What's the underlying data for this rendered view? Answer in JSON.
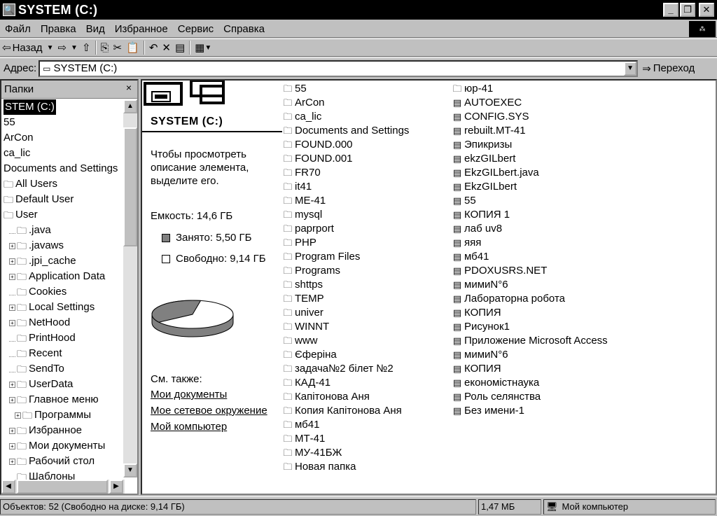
{
  "window": {
    "title": "SYSTEM (C:)"
  },
  "menu": [
    "Файл",
    "Правка",
    "Вид",
    "Избранное",
    "Сервис",
    "Справка"
  ],
  "toolbar": {
    "back_label": "Назад"
  },
  "address": {
    "label": "Адрес:",
    "value": "SYSTEM (C:)",
    "go_label": "Переход"
  },
  "folders": {
    "header": "Папки",
    "close": "×",
    "items": [
      {
        "label": "STEM (C:)",
        "indent": 0,
        "selected": true,
        "plus": false,
        "icon": false
      },
      {
        "label": "55",
        "indent": 0,
        "plus": false,
        "icon": false
      },
      {
        "label": "ArCon",
        "indent": 0,
        "plus": false,
        "icon": false
      },
      {
        "label": "ca_lic",
        "indent": 0,
        "plus": false,
        "icon": false
      },
      {
        "label": "Documents and Settings",
        "indent": 0,
        "plus": false,
        "icon": false
      },
      {
        "label": "All Users",
        "indent": 0,
        "plus": false,
        "icon": true
      },
      {
        "label": "Default User",
        "indent": 0,
        "plus": false,
        "icon": true
      },
      {
        "label": "User",
        "indent": 0,
        "plus": false,
        "icon": true
      },
      {
        "label": ".java",
        "indent": 1,
        "plus": false,
        "icon": true
      },
      {
        "label": ".javaws",
        "indent": 1,
        "plus": true,
        "icon": true
      },
      {
        "label": ".jpi_cache",
        "indent": 1,
        "plus": true,
        "icon": true
      },
      {
        "label": "Application Data",
        "indent": 1,
        "plus": true,
        "icon": true
      },
      {
        "label": "Cookies",
        "indent": 1,
        "plus": false,
        "icon": true
      },
      {
        "label": "Local Settings",
        "indent": 1,
        "plus": true,
        "icon": true
      },
      {
        "label": "NetHood",
        "indent": 1,
        "plus": true,
        "icon": true
      },
      {
        "label": "PrintHood",
        "indent": 1,
        "plus": false,
        "icon": true
      },
      {
        "label": "Recent",
        "indent": 1,
        "plus": false,
        "icon": true
      },
      {
        "label": "SendTo",
        "indent": 1,
        "plus": false,
        "icon": true
      },
      {
        "label": "UserData",
        "indent": 1,
        "plus": true,
        "icon": true
      },
      {
        "label": "Главное меню",
        "indent": 1,
        "plus": true,
        "icon": true
      },
      {
        "label": "Программы",
        "indent": 2,
        "plus": true,
        "icon": true
      },
      {
        "label": "Избранное",
        "indent": 1,
        "plus": true,
        "icon": true
      },
      {
        "label": "Мои документы",
        "indent": 1,
        "plus": true,
        "icon": true
      },
      {
        "label": "Рабочий стол",
        "indent": 1,
        "plus": true,
        "icon": true
      },
      {
        "label": "Шаблоны",
        "indent": 1,
        "plus": false,
        "icon": true
      }
    ]
  },
  "info": {
    "title": "SYSTEM (C:)",
    "hint": "Чтобы просмотреть описание элемента, выделите его.",
    "capacity": "Емкость: 14,6 ГБ",
    "used": "Занято: 5,50 ГБ",
    "free": "Свободно: 9,14 ГБ",
    "used_fraction": 0.377,
    "see_also": "См. также:",
    "links": [
      "Мои документы",
      "Мое сетевое окружение",
      "Мой компьютер"
    ]
  },
  "files_col1": [
    "55",
    "ArCon",
    "ca_lic",
    "Documents and Settings",
    "FOUND.000",
    "FOUND.001",
    "FR70",
    "it41",
    "ME-41",
    "mysql",
    "paprport",
    "PHP",
    "Program Files",
    "Programs",
    "shttps",
    "TEMP",
    "univer",
    "WINNT",
    "www",
    "Єферіна",
    "задача№2 білет №2",
    "КАД-41",
    "Капітонова Аня",
    "Копия Капітонова Аня",
    "мб41",
    "МТ-41",
    "МУ-41БЖ",
    "Новая папка"
  ],
  "files_col2": [
    "юр-41",
    "AUTOEXEC",
    "CONFIG.SYS",
    "rebuilt.MT-41",
    "Эпикризы",
    "ekzGILbert",
    "EkzGILbert.java",
    "EkzGILbert",
    "55",
    "КОПИЯ 1",
    "лаб uv8",
    "яяя",
    "мб41",
    "PDOXUSRS.NET",
    "мимиN°6",
    "Лабораторна робота",
    "КОПИЯ",
    "Рисунок1",
    "Приложение Microsoft Access",
    "мимиN°6",
    "КОПИЯ",
    "економістнаука",
    "Роль селянства",
    "Без имени-1"
  ],
  "status": {
    "objects": "Объектов: 52 (Свободно на диске: 9,14 ГБ)",
    "size": "1,47 МБ",
    "location": "Мой компьютер"
  }
}
